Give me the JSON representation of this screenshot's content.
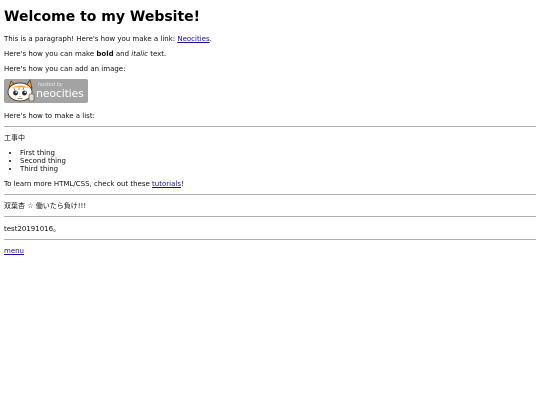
{
  "heading": "Welcome to my Website!",
  "intro": {
    "before_link": "This is a paragraph! Here's how you make a link: ",
    "link_text": "Neocities",
    "after_link": "."
  },
  "formatting": {
    "before_bold": "Here's how you can make ",
    "bold_word": "bold",
    "middle": " and ",
    "italic_word": "italic",
    "after_italic": " text."
  },
  "image_intro": "Here's how you can add an image:",
  "badge": {
    "small_text": "hosted by",
    "brand_text": "neocities"
  },
  "list_intro": "Here's how to make a list:",
  "construction_note": "工事中",
  "list_items": [
    "First thing",
    "Second thing",
    "Third thing"
  ],
  "tutorials": {
    "before_link": "To learn more HTML/CSS, check out these ",
    "link_text": "tutorials",
    "after_link": "!"
  },
  "quote": "双葉杏 ☆ 働いたら負け!!!",
  "test_line": "test20191016。",
  "menu_link": "menu"
}
